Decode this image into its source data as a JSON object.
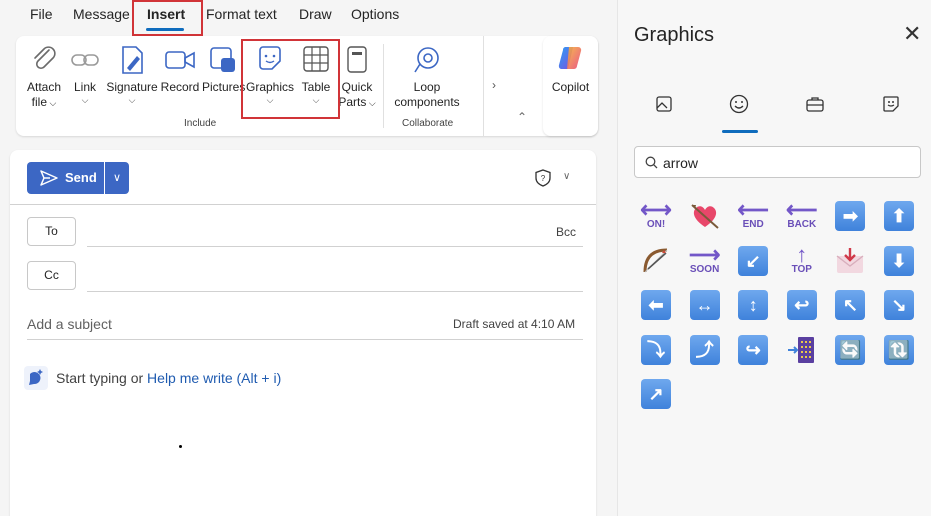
{
  "menu": {
    "tabs": [
      {
        "label": "File"
      },
      {
        "label": "Message"
      },
      {
        "label": "Insert"
      },
      {
        "label": "Format text"
      },
      {
        "label": "Draw"
      },
      {
        "label": "Options"
      }
    ],
    "active": "Insert"
  },
  "ribbon": {
    "attach": {
      "line1": "Attach",
      "line2": "file"
    },
    "link": "Link",
    "signature": "Signature",
    "record": "Record",
    "pictures": "Pictures",
    "graphics": "Graphics",
    "table": "Table",
    "quickparts": {
      "line1": "Quick",
      "line2": "Parts"
    },
    "include_label": "Include",
    "loop": {
      "line1": "Loop",
      "line2": "components"
    },
    "collaborate_label": "Collaborate",
    "copilot": "Copilot"
  },
  "compose": {
    "send_label": "Send",
    "to_label": "To",
    "cc_label": "Cc",
    "bcc_label": "Bcc",
    "subject_placeholder": "Add a subject",
    "draft_status": "Draft saved at 4:10 AM",
    "hint_prefix": "Start typing or ",
    "hint_link": "Help me write (Alt + i)"
  },
  "graphics_pane": {
    "title": "Graphics",
    "tabs": [
      "images-icon",
      "emoji-icon",
      "briefcase-icon",
      "sticker-icon"
    ],
    "active_tab": "emoji-icon",
    "search_value": "arrow",
    "emoji": [
      {
        "name": "on-arrow-emoji",
        "kind": "word",
        "arrow": "⟷",
        "word": "ON!"
      },
      {
        "name": "heart-with-arrow-emoji",
        "kind": "heart"
      },
      {
        "name": "end-arrow-emoji",
        "kind": "word",
        "arrow": "⟵",
        "word": "END"
      },
      {
        "name": "back-arrow-emoji",
        "kind": "word",
        "arrow": "⟵",
        "word": "BACK"
      },
      {
        "name": "right-arrow-emoji",
        "kind": "box",
        "glyph": "➡"
      },
      {
        "name": "up-arrow-emoji",
        "kind": "box",
        "glyph": "⬆"
      },
      {
        "name": "bow-and-arrow-emoji",
        "kind": "bow"
      },
      {
        "name": "soon-arrow-emoji",
        "kind": "word",
        "arrow": "⟶",
        "word": "SOON"
      },
      {
        "name": "down-left-arrow-emoji",
        "kind": "box",
        "glyph": "↙"
      },
      {
        "name": "top-arrow-emoji",
        "kind": "word",
        "arrow": "↑",
        "word": "TOP"
      },
      {
        "name": "envelope-with-arrow-emoji",
        "kind": "envelope"
      },
      {
        "name": "down-arrow-emoji",
        "kind": "box",
        "glyph": "⬇"
      },
      {
        "name": "left-arrow-emoji",
        "kind": "box",
        "glyph": "⬅"
      },
      {
        "name": "left-right-arrow-emoji",
        "kind": "box",
        "glyph": "↔"
      },
      {
        "name": "up-down-arrow-emoji",
        "kind": "box",
        "glyph": "↕"
      },
      {
        "name": "right-arrow-curving-left-emoji",
        "kind": "box",
        "glyph": "↩"
      },
      {
        "name": "up-left-arrow-emoji",
        "kind": "box",
        "glyph": "↖"
      },
      {
        "name": "down-right-arrow-emoji",
        "kind": "box",
        "glyph": "↘"
      },
      {
        "name": "right-arrow-curving-down-emoji",
        "kind": "box",
        "glyph": "⤵"
      },
      {
        "name": "right-arrow-curving-up-emoji",
        "kind": "box",
        "glyph": "⤴"
      },
      {
        "name": "left-arrow-curving-right-emoji",
        "kind": "box",
        "glyph": "↪"
      },
      {
        "name": "door-arrow-emoji",
        "kind": "door"
      },
      {
        "name": "counterclockwise-arrows-emoji",
        "kind": "box",
        "glyph": "🔄"
      },
      {
        "name": "clockwise-arrows-emoji",
        "kind": "box",
        "glyph": "🔃"
      },
      {
        "name": "up-right-arrow-emoji",
        "kind": "box",
        "glyph": "↗"
      }
    ]
  },
  "colors": {
    "accent": "#0f6cbd",
    "send": "#3c67c4",
    "highlight": "#d13438"
  }
}
